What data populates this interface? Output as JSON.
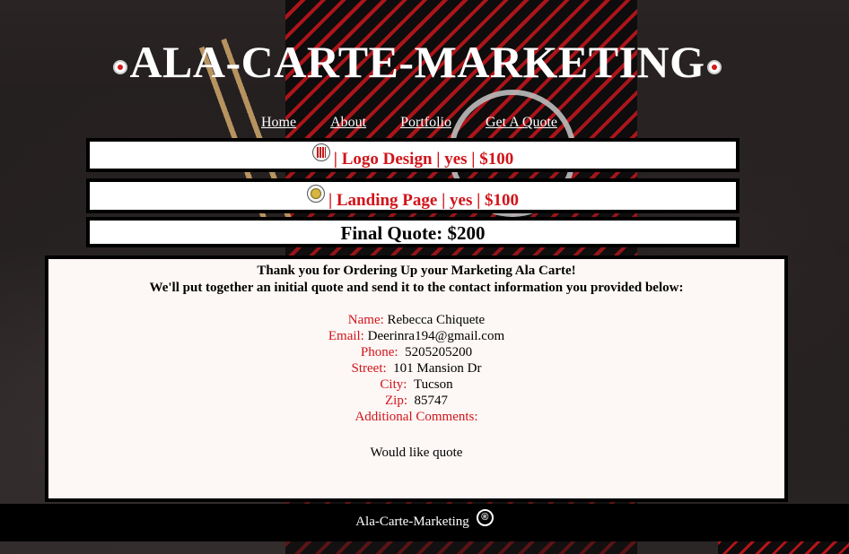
{
  "header": {
    "title": "ALA-CARTE-MARKETING"
  },
  "nav": {
    "items": [
      "Home",
      "About",
      "Portfolio",
      "Get A Quote"
    ]
  },
  "quotes": {
    "items": [
      {
        "text": "| Logo Design | yes | $100",
        "icon": "logo-design-icon"
      },
      {
        "text": "| Landing Page | yes | $100",
        "icon": "landing-page-icon"
      }
    ],
    "final": "Final Quote: $200"
  },
  "confirmation": {
    "heading1": "Thank you for Ordering Up your Marketing Ala Carte!",
    "heading2": "We'll put together an initial quote and send it to the contact information you provided below:",
    "fields": {
      "name": {
        "label": "Name:",
        "value": "Rebecca Chiquete"
      },
      "email": {
        "label": "Email:",
        "value": "Deerinra194@gmail.com"
      },
      "phone": {
        "label": "Phone:",
        "value": "5205205200"
      },
      "street": {
        "label": "Street:",
        "value": "101 Mansion Dr"
      },
      "city": {
        "label": "City:",
        "value": "Tucson"
      },
      "zip": {
        "label": "Zip:",
        "value": "85747"
      },
      "comments": {
        "label": "Additional Comments:",
        "value": "Would like quote"
      }
    }
  },
  "footer": {
    "text": "Ala-Carte-Marketing",
    "registered": "®"
  },
  "colors": {
    "accent_red": "#d1141a",
    "panel_bg": "#fdf7f5"
  }
}
